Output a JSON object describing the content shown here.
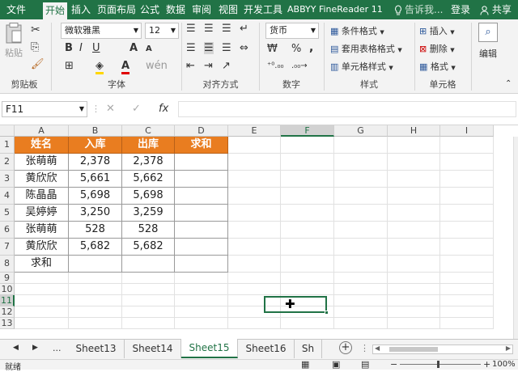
{
  "tabs": {
    "file": "文件",
    "home": "开始",
    "insert": "插入",
    "layout": "页面布局",
    "formulas": "公式",
    "data": "数据",
    "review": "审阅",
    "view": "视图",
    "developer": "开发工具",
    "abbyy": "ABBYY FineReader 11",
    "tell": "告诉我...",
    "login": "登录",
    "share": "共享"
  },
  "ribbon": {
    "clipboard": {
      "paste": "粘贴",
      "group": "剪贴板"
    },
    "font": {
      "name": "微软雅黑",
      "size": "12",
      "bold": "B",
      "italic": "I",
      "underline": "U",
      "grow": "A",
      "shrink": "A",
      "color_a": "A",
      "group": "字体"
    },
    "align": {
      "group": "对齐方式"
    },
    "number": {
      "format": "货币",
      "currency": "₩",
      "percent": "%",
      "comma": ",",
      "group": "数字"
    },
    "styles": {
      "cond": "条件格式",
      "table": "套用表格格式",
      "cell": "单元格样式",
      "group": "样式"
    },
    "cells": {
      "insert": "插入",
      "delete": "删除",
      "format": "格式",
      "group": "单元格"
    },
    "edit": {
      "label": "编辑"
    }
  },
  "formula_bar": {
    "name_box": "F11",
    "cancel": "✕",
    "enter": "✓",
    "fx": "fx",
    "value": ""
  },
  "columns": [
    "A",
    "B",
    "C",
    "D",
    "E",
    "F",
    "G",
    "H",
    "I"
  ],
  "rows": [
    "1",
    "2",
    "3",
    "4",
    "5",
    "6",
    "7",
    "8",
    "9",
    "10",
    "11",
    "12",
    "13"
  ],
  "table": {
    "headers": [
      "姓名",
      "入库",
      "出库",
      "求和"
    ],
    "rows": [
      [
        "张萌萌",
        "2,378",
        "2,378",
        ""
      ],
      [
        "黄欣欣",
        "5,661",
        "5,662",
        ""
      ],
      [
        "陈晶晶",
        "5,698",
        "5,698",
        ""
      ],
      [
        "吴婷婷",
        "3,250",
        "3,259",
        ""
      ],
      [
        "张萌萌",
        "528",
        "528",
        ""
      ],
      [
        "黄欣欣",
        "5,682",
        "5,682",
        ""
      ],
      [
        "求和",
        "",
        "",
        ""
      ]
    ]
  },
  "selection": {
    "cell": "F11"
  },
  "sheets": {
    "ellipsis": "...",
    "tabs": [
      "Sheet13",
      "Sheet14",
      "Sheet15",
      "Sheet16",
      "Sh"
    ],
    "active": "Sheet15",
    "add": "+"
  },
  "status": {
    "ready": "就绪",
    "zoom": "100%"
  },
  "colors": {
    "accent": "#217346",
    "header_fill": "#e97d20"
  }
}
